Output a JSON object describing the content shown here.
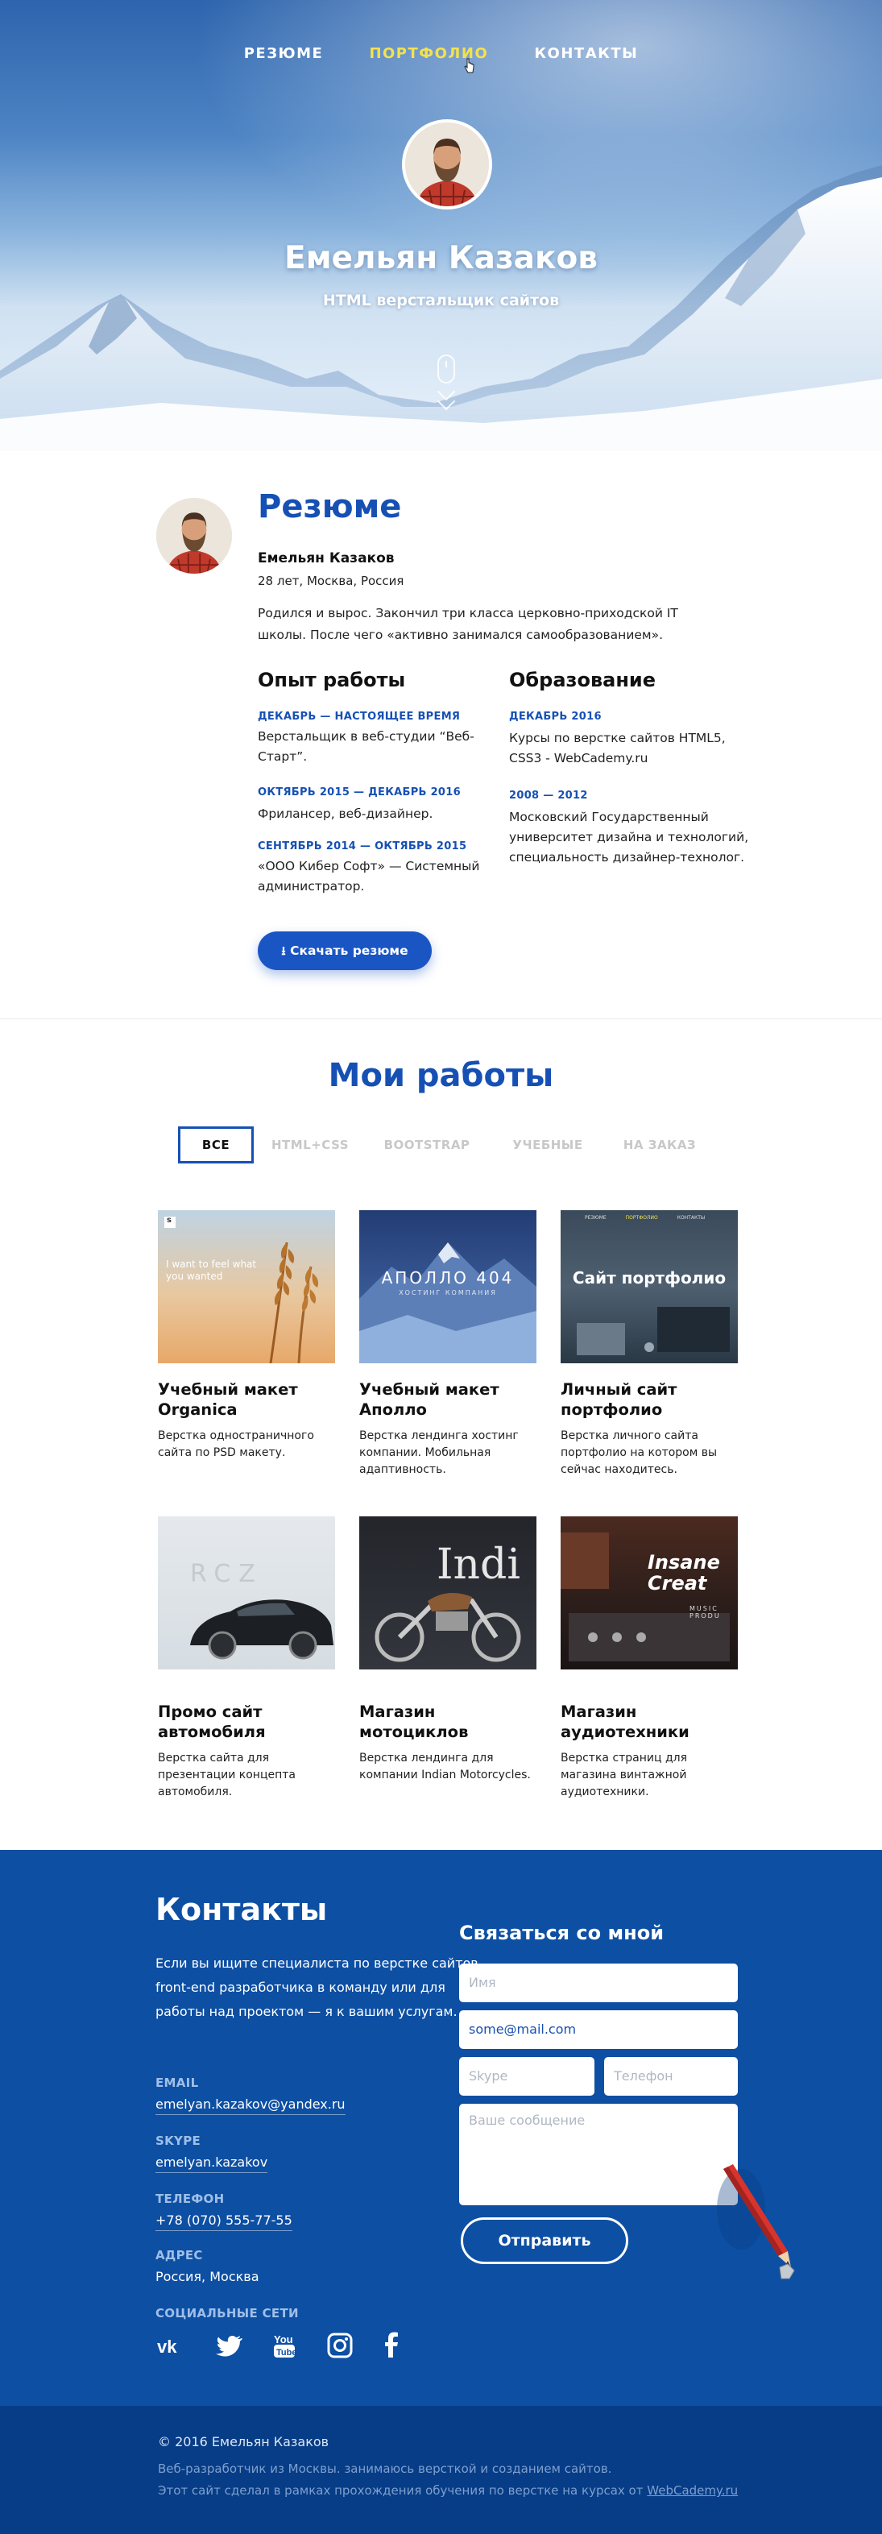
{
  "nav": {
    "items": [
      {
        "label": "РЕЗЮМЕ"
      },
      {
        "label": "ПОРТФОЛИО"
      },
      {
        "label": "КОНТАКТЫ"
      }
    ]
  },
  "hero": {
    "name": "Емельян Казаков",
    "subtitle": "HTML верстальщик сайтов"
  },
  "resume": {
    "title": "Резюме",
    "name": "Емельян Казаков",
    "age_location": "28 лет, Москва, Россия",
    "bio": "Родился и вырос. Закончил три класса церковно-приходской IT школы. После чего «активно занимался самообразованием».",
    "experience": {
      "title": "Опыт работы",
      "items": [
        {
          "date": "ДЕКАБРЬ — НАСТОЯЩЕЕ ВРЕМЯ",
          "text": "Верстальщик в веб-студии “Веб-Старт”."
        },
        {
          "date": "ОКТЯБРЬ 2015 — ДЕКАБРЬ 2016",
          "text": "Фрилансер, веб-дизайнер."
        },
        {
          "date": "СЕНТЯБРЬ 2014 — ОКТЯБРЬ 2015",
          "text": "«ООО Кибер Софт» — Системный администратор."
        }
      ]
    },
    "education": {
      "title": "Образование",
      "items": [
        {
          "date": "ДЕКАБРЬ 2016",
          "text": "Курсы по верстке сайтов HTML5, CSS3 - WebCademy.ru"
        },
        {
          "date": "2008 — 2012",
          "text": "Московский Государственный университет дизайна и технологий, специальность дизайнер-технолог."
        }
      ]
    },
    "download_label": "Скачать резюме"
  },
  "works": {
    "title": "Мои работы",
    "filters": [
      "ВСЕ",
      "HTML+CSS",
      "BOOTSTRAP",
      "УЧЕБНЫЕ",
      "НА ЗАКАЗ"
    ],
    "active_filter": "ВСЕ",
    "cards": [
      {
        "title": "Учебный макет Organica",
        "desc": "Верстка одностраничного сайта по PSD макету.",
        "image_text": "I want to feel what you wanted",
        "image_logo": "s"
      },
      {
        "title": "Учебный макет Аполло",
        "desc": "Верстка лендинга хостинг компании. Мобильная адаптивность.",
        "image_text": "АПОЛЛО 404",
        "image_subtext": "ХОСТИНГ КОМПАНИЯ"
      },
      {
        "title": "Личный сайт портфолио",
        "desc": "Верстка личного сайта портфолио на котором вы сейчас находитесь.",
        "image_text": "Сайт портфолио",
        "image_nav": [
          "РЕЗЮМЕ",
          "ПОРТФОЛИО",
          "КОНТАКТЫ"
        ]
      },
      {
        "title": "Промо сайт автомобиля",
        "desc": "Верстка сайта для презентации концепта автомобиля.",
        "image_text": "RCZ"
      },
      {
        "title": "Магазин мотоциклов",
        "desc": "Верстка лендинга для компании Indian Motorcycles.",
        "image_text": "Indi"
      },
      {
        "title": "Магазин аудиотехники",
        "desc": "Верстка страниц для магазина винтажной аудиотехники.",
        "image_text": "Insane Creat",
        "image_subtext": "MUSIC PRODU"
      }
    ]
  },
  "contacts": {
    "title": "Контакты",
    "intro": "Если вы ищите специалиста по верстке сайтов, front-end разработчика в команду или для работы над проектом —  я к вашим услугам.",
    "email_label": "EMAIL",
    "email": "emelyan.kazakov@yandex.ru",
    "skype_label": "SKYPE",
    "skype": "emelyan.kazakov",
    "phone_label": "ТЕЛЕФОН",
    "phone": "+78 (070) 555-77-55",
    "address_label": "АДРЕС",
    "address": "Россия, Москва",
    "social_label": "СОЦИАЛЬНЫЕ СЕТИ",
    "social": [
      "vk-icon",
      "twitter-icon",
      "youtube-icon",
      "instagram-icon",
      "facebook-icon"
    ]
  },
  "form": {
    "title": "Связаться со мной",
    "name_placeholder": "Имя",
    "email_value": "some@mail.com",
    "skype_placeholder": "Skype",
    "phone_placeholder": "Телефон",
    "message_placeholder": "Ваше сообщение",
    "send_label": "Отправить"
  },
  "footer": {
    "copyright": "© 2016 Емельян Казаков",
    "line1": "Веб-разработчик из Москвы. занимаюсь версткой и созданием сайтов.",
    "line2_prefix": "Этот сайт сделал в рамках прохождения обучения по верстке на курсах от",
    "line2_link": "WebCademy.ru"
  },
  "colors": {
    "accent": "#1650b4",
    "nav_active": "#f3e24c",
    "contacts_bg": "#0d4fa3",
    "footer_bg": "#073c86"
  }
}
